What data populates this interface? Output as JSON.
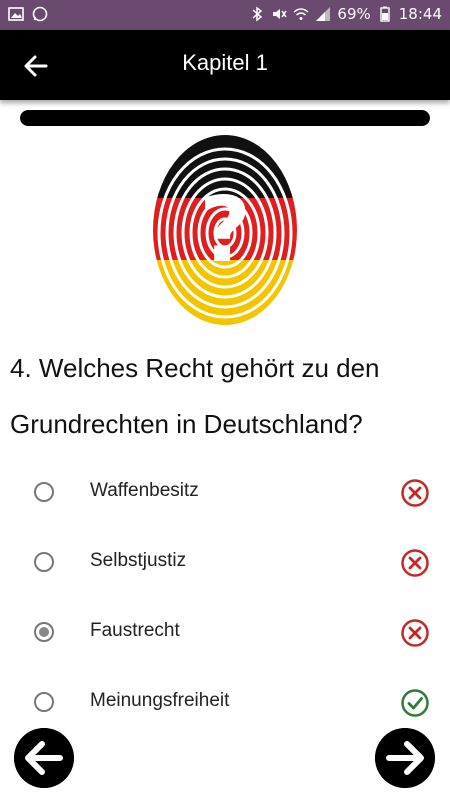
{
  "status_bar": {
    "battery": "69%",
    "time": "18:44"
  },
  "app_bar": {
    "title": "Kapitel 1",
    "back_icon": "arrow-left-icon"
  },
  "progress": {
    "fraction": 1.0
  },
  "question": {
    "text": "4. Welches Recht gehört zu den Grundrechten in Deutschland?"
  },
  "answers": [
    {
      "label": "Waffenbesitz",
      "selected": false,
      "result": "wrong"
    },
    {
      "label": "Selbstjustiz",
      "selected": false,
      "result": "wrong"
    },
    {
      "label": "Faustrecht",
      "selected": true,
      "result": "wrong"
    },
    {
      "label": "Meinungsfreiheit",
      "selected": false,
      "result": "correct"
    }
  ],
  "colors": {
    "status_bar": "#6a4a6e",
    "app_bar": "#000000",
    "wrong": "#c62828",
    "correct": "#2e7d32"
  },
  "navigation": {
    "prev_icon": "arrow-left-icon",
    "next_icon": "arrow-right-icon"
  }
}
